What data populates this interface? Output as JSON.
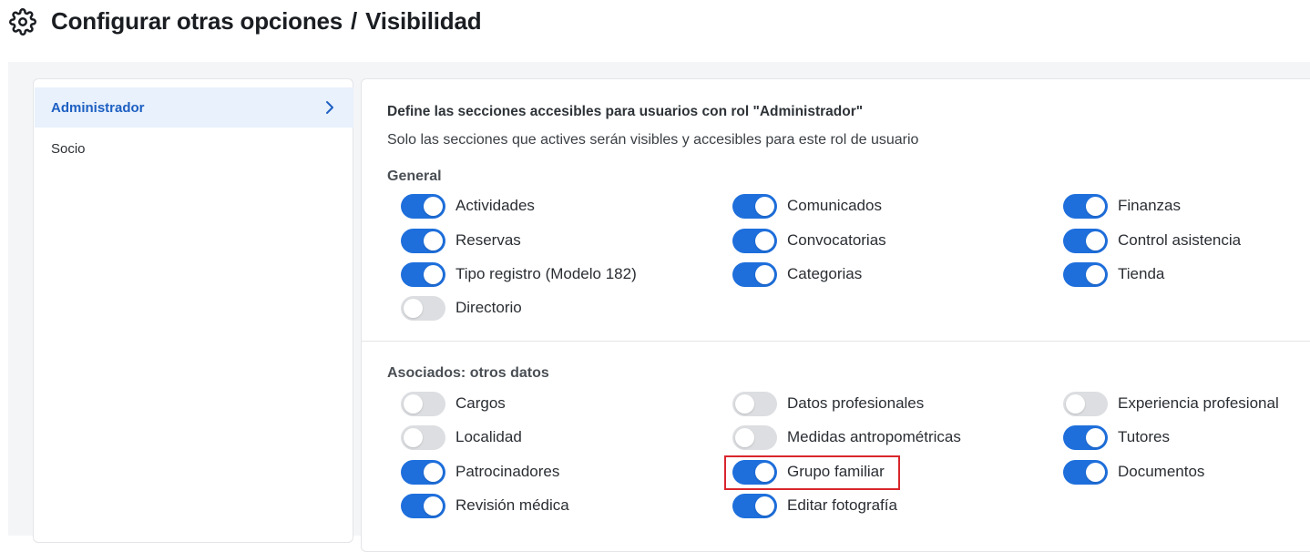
{
  "header": {
    "title_part1": "Configurar otras opciones",
    "separator": "/",
    "title_part2": "Visibilidad",
    "icon": "gear-icon"
  },
  "sidebar": {
    "items": [
      {
        "label": "Administrador",
        "active": true
      },
      {
        "label": "Socio",
        "active": false
      }
    ]
  },
  "main": {
    "heading": "Define las secciones accesibles para usuarios con rol \"Administrador\"",
    "subheading": "Solo las secciones que actives serán visibles y accesibles para este rol de usuario",
    "sections": [
      {
        "title": "General",
        "options": [
          {
            "label": "Actividades",
            "on": true
          },
          {
            "label": "Comunicados",
            "on": true
          },
          {
            "label": "Finanzas",
            "on": true
          },
          {
            "label": "Reservas",
            "on": true
          },
          {
            "label": "Convocatorias",
            "on": true
          },
          {
            "label": "Control asistencia",
            "on": true
          },
          {
            "label": "Tipo registro (Modelo 182)",
            "on": true
          },
          {
            "label": "Categorias",
            "on": true
          },
          {
            "label": "Tienda",
            "on": true
          },
          {
            "label": "Directorio",
            "on": false
          }
        ]
      },
      {
        "title": "Asociados: otros datos",
        "options": [
          {
            "label": "Cargos",
            "on": false
          },
          {
            "label": "Datos profesionales",
            "on": false
          },
          {
            "label": "Experiencia profesional",
            "on": false
          },
          {
            "label": "Localidad",
            "on": false
          },
          {
            "label": "Medidas antropométricas",
            "on": false
          },
          {
            "label": "Tutores",
            "on": true
          },
          {
            "label": "Patrocinadores",
            "on": true
          },
          {
            "label": "Grupo familiar",
            "on": true
          },
          {
            "label": "Documentos",
            "on": true
          },
          {
            "label": "Revisión médica",
            "on": true
          },
          {
            "label": "Editar fotografía",
            "on": true
          }
        ]
      }
    ]
  },
  "colors": {
    "toggle_on": "#1e6fdc",
    "toggle_off": "#dcdee1",
    "active_item_bg": "#e8f1fc",
    "active_item_text": "#1d5fc2",
    "highlight_border": "#d9262c"
  }
}
